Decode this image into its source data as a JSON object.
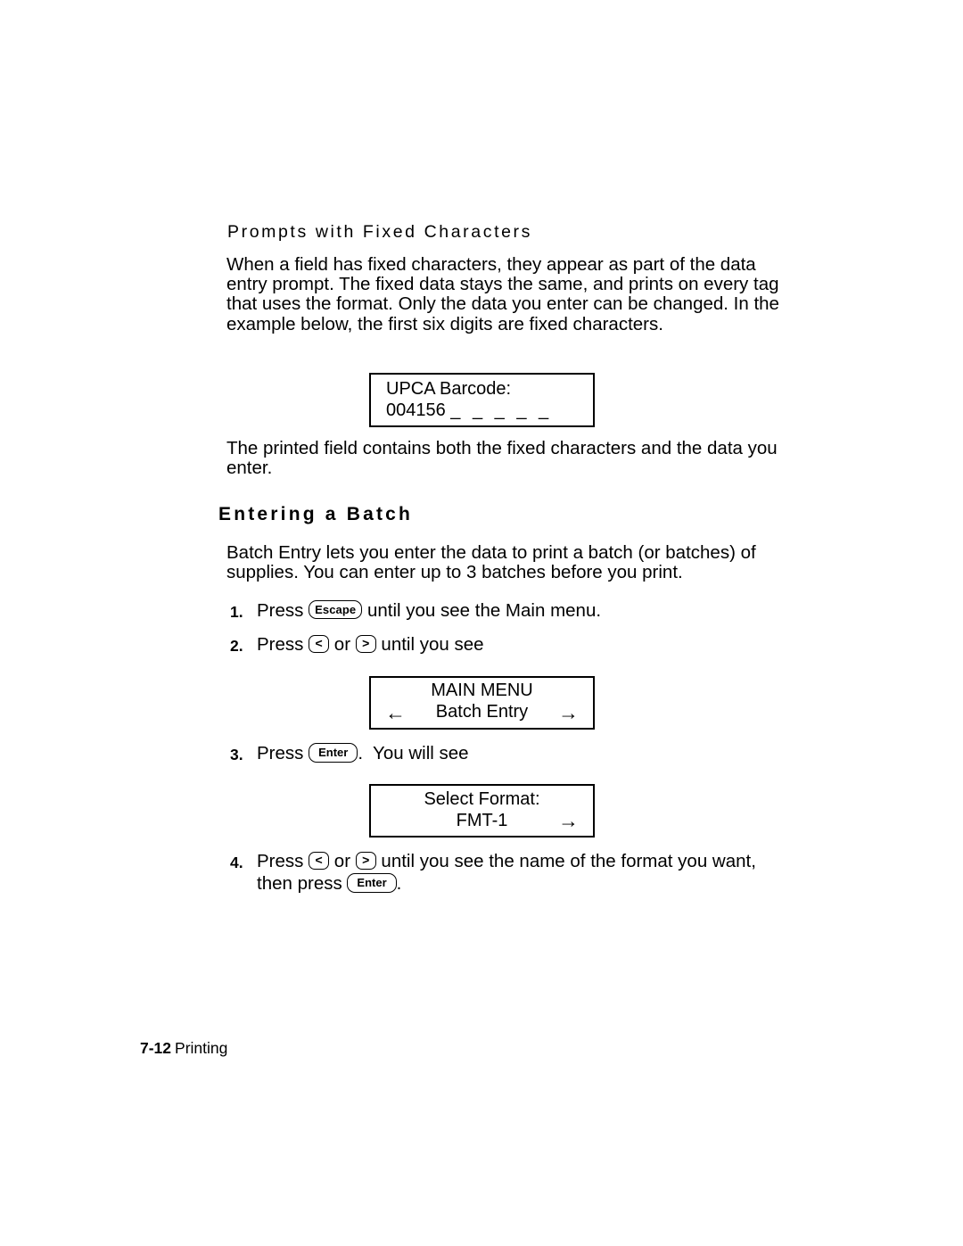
{
  "page": {
    "subheading": "Prompts with Fixed Characters",
    "section_heading": "Entering a Batch"
  },
  "paragraphs": {
    "fixed_chars": "When a field has fixed characters, they appear as part of the data entry prompt.  The fixed data stays the same, and prints on every tag that uses the format.  Only the data you enter can be changed.  In the example below, the first six digits are fixed characters.",
    "printed_field": "The printed field contains both the fixed characters and the data you enter.",
    "batch_entry": "Batch Entry lets you enter the data to print a batch (or batches) of supplies.  You can enter up to 3 batches before you print."
  },
  "displays": {
    "upca": {
      "line1": "UPCA Barcode:",
      "line2_value": "004156 ",
      "line2_blanks": "_ _ _ _ _"
    },
    "main_menu": {
      "line1": "MAIN MENU",
      "line2": "Batch Entry",
      "arrow_left": "←",
      "arrow_right": "→"
    },
    "select_format": {
      "line1": "Select Format:",
      "line2": "FMT-1",
      "arrow_right": "→"
    }
  },
  "steps": [
    {
      "number": "1.",
      "text_before": "Press ",
      "key": "Escape",
      "text_after": " until you see the Main menu."
    },
    {
      "number": "2.",
      "text_before": "Press ",
      "key_left": "<",
      "text_mid": " or ",
      "key_right": ">",
      "text_after": " until you see"
    },
    {
      "number": "3.",
      "text_before": "Press ",
      "key": "Enter",
      "text_after": ".  You will see"
    },
    {
      "number": "4.",
      "text_before": "Press ",
      "key_left": "<",
      "text_mid": " or ",
      "key_right": ">",
      "text_after": " until you see the name of the format you want,",
      "line2_before": "then press ",
      "line2_key": "Enter",
      "line2_after": "."
    }
  ],
  "footer": {
    "page_number": "7-12",
    "chapter": "Printing"
  },
  "colors": {
    "text": "#000000",
    "background": "#ffffff",
    "border": "#000000"
  }
}
